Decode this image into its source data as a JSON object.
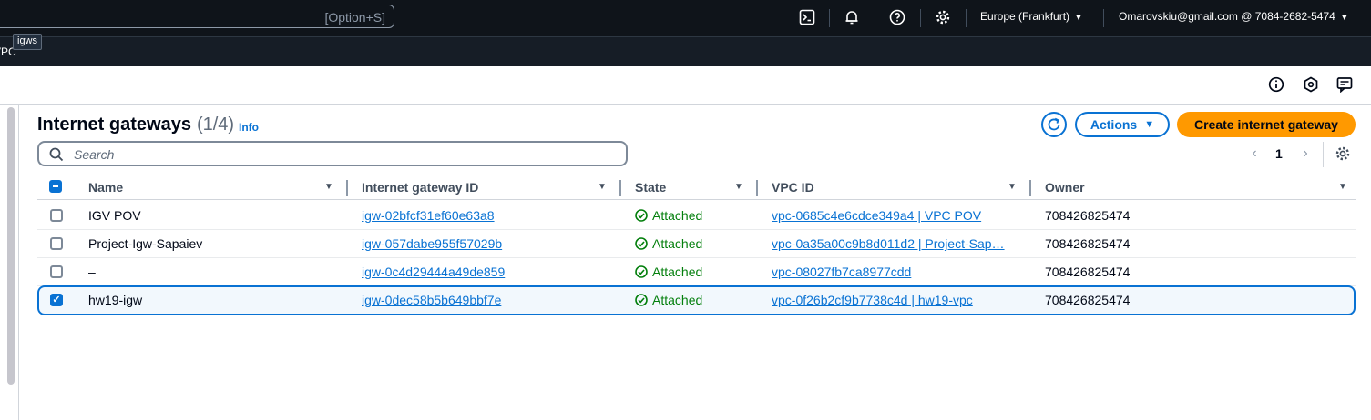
{
  "topbar": {
    "search_shortcut": "[Option+S]",
    "region": "Europe (Frankfurt)",
    "account": "Omarovskiu@gmail.com @ 7084-2682-5474",
    "icons": [
      "cloudshell-icon",
      "bell-icon",
      "help-icon",
      "gear-icon"
    ]
  },
  "tooltip": "igws",
  "service": "VPC",
  "page": {
    "title": "Internet gateways",
    "count": "(1/4)",
    "info": "Info",
    "actions_label": "Actions",
    "create_label": "Create internet gateway",
    "search_placeholder": "Search",
    "page_number": "1"
  },
  "table": {
    "headers": [
      "Name",
      "Internet gateway ID",
      "State",
      "VPC ID",
      "Owner"
    ],
    "rows": [
      {
        "name": "IGV POV",
        "igw_id": "igw-02bfcf31ef60e63a8",
        "state": "Attached",
        "vpc_id": "vpc-0685c4e6cdce349a4 | VPC POV",
        "owner": "708426825474",
        "selected": false
      },
      {
        "name": "Project-Igw-Sapaiev",
        "igw_id": "igw-057dabe955f57029b",
        "state": "Attached",
        "vpc_id": "vpc-0a35a00c9b8d011d2 | Project-Sap…",
        "owner": "708426825474",
        "selected": false
      },
      {
        "name": "–",
        "igw_id": "igw-0c4d29444a49de859",
        "state": "Attached",
        "vpc_id": "vpc-08027fb7ca8977cdd",
        "owner": "708426825474",
        "selected": false
      },
      {
        "name": "hw19-igw",
        "igw_id": "igw-0dec58b5b649bbf7e",
        "state": "Attached",
        "vpc_id": "vpc-0f26b2cf9b7738c4d | hw19-vpc",
        "owner": "708426825474",
        "selected": true
      }
    ]
  },
  "colors": {
    "accent": "#0972d3",
    "primary_button": "#ff9900",
    "success": "#037f0c",
    "topbar": "#0f141a"
  }
}
